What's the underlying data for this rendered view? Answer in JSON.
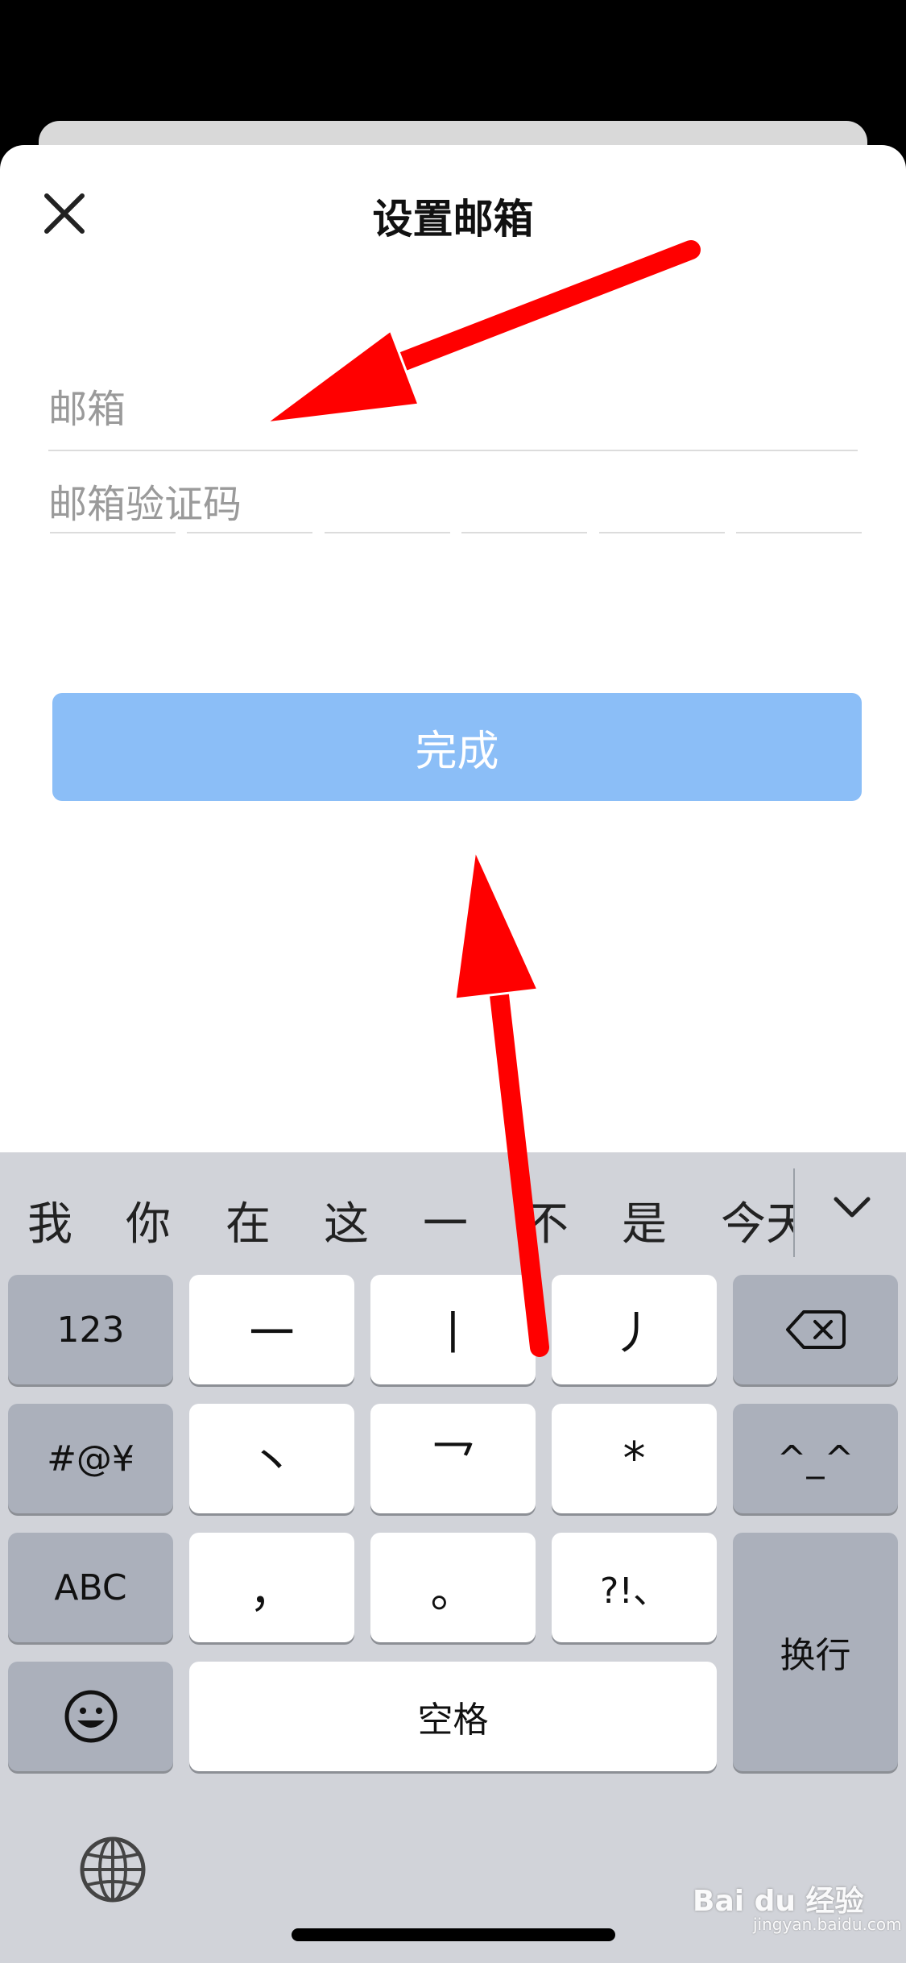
{
  "sheet": {
    "title": "设置邮箱",
    "email_placeholder": "邮箱",
    "code_placeholder": "邮箱验证码",
    "done_label": "完成"
  },
  "keyboard": {
    "candidates": [
      "我",
      "你",
      "在",
      "这",
      "一",
      "不",
      "是",
      "今天"
    ],
    "keys": {
      "num": "123",
      "stroke_h": "一",
      "stroke_s": "丨",
      "stroke_p": "丿",
      "symbols": "#@¥",
      "stroke_d": "丶",
      "stroke_z": "乛",
      "star": "*",
      "kaomoji": "^_^",
      "abc": "ABC",
      "comma": "，",
      "period": "。",
      "punct": "?!、",
      "newline": "换行",
      "space": "空格"
    }
  },
  "watermark": {
    "brand": "Bai du 经验",
    "url": "jingyan.baidu.com"
  },
  "colors": {
    "done_button": "#8bbef7",
    "arrow": "#ff0000",
    "keyboard_bg": "#d1d3d9"
  }
}
